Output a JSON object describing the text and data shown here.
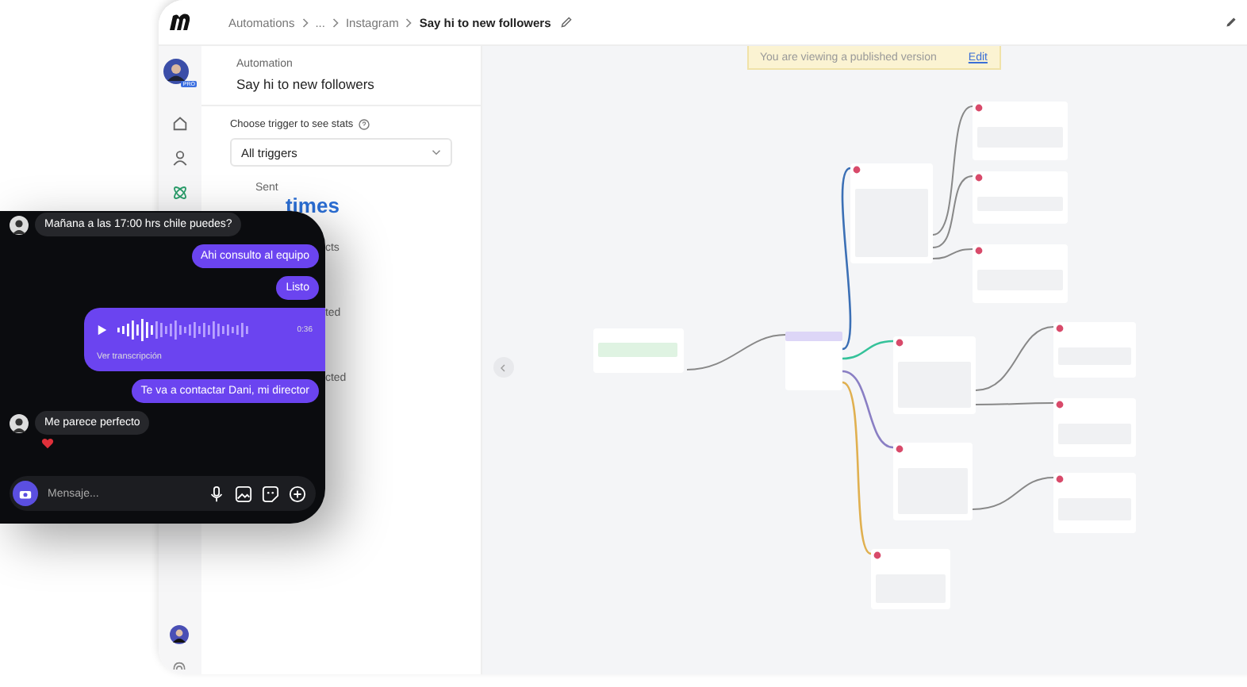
{
  "breadcrumb": [
    {
      "label": "Automations",
      "current": false
    },
    {
      "label": "...",
      "current": false
    },
    {
      "label": "Instagram",
      "current": false
    },
    {
      "label": "Say hi to new followers",
      "current": true
    }
  ],
  "rail": {
    "badge": "PRO",
    "items": [
      {
        "kind": "home",
        "selected": false
      },
      {
        "kind": "contacts",
        "selected": false
      },
      {
        "kind": "automation",
        "selected": true
      }
    ]
  },
  "panel": {
    "label": "Automation",
    "title": "Say hi to new followers",
    "trigger_label": "Choose trigger to see stats",
    "trigger_value": "All triggers",
    "stats": [
      {
        "kind": "label",
        "text": "Sent"
      },
      {
        "kind": "value",
        "text": "times"
      },
      {
        "kind": "fragment",
        "text": "cts"
      },
      {
        "kind": "fragment",
        "text": "ted"
      },
      {
        "kind": "fragment",
        "text": "cted"
      }
    ]
  },
  "banner": {
    "text": "You are viewing a published version",
    "action": "Edit"
  },
  "chat": {
    "messages": [
      {
        "kind": "incoming",
        "text": "Mañana a las 17:00 hrs chile puedes?",
        "reaction": false
      },
      {
        "kind": "outgoing",
        "text": "Ahi consulto al equipo",
        "reaction": false
      },
      {
        "kind": "outgoing",
        "text": "Listo",
        "reaction": false
      },
      {
        "kind": "voice",
        "duration": "0:36",
        "link": "Ver transcripción"
      },
      {
        "kind": "outgoing",
        "text": "Te va a contactar Dani, mi director",
        "reaction": false
      },
      {
        "kind": "incoming",
        "text": "Me parece perfecto",
        "reaction": true
      }
    ],
    "composer": {
      "placeholder": "Mensaje..."
    }
  }
}
